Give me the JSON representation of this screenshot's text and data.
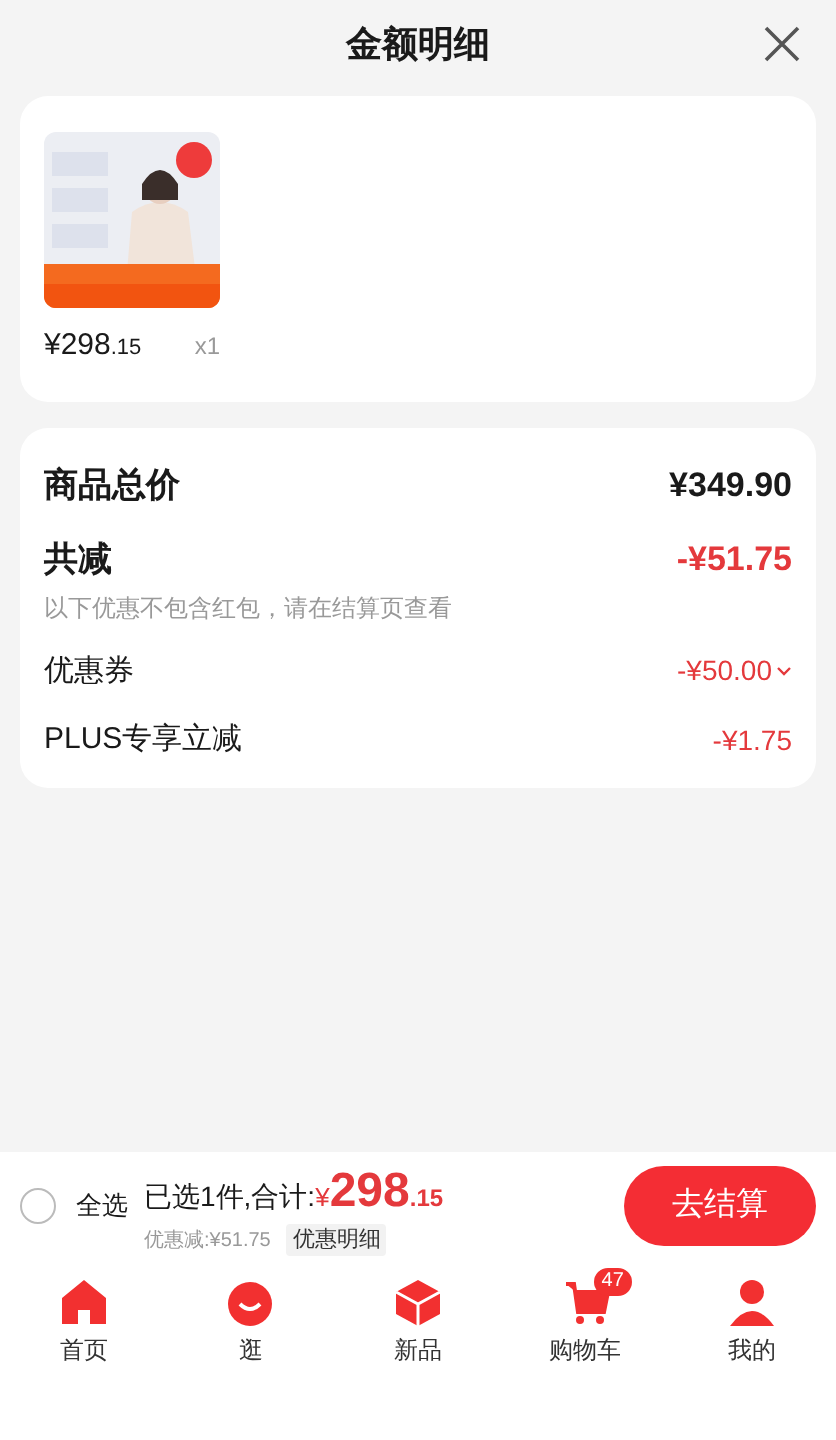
{
  "header": {
    "title": "金额明细"
  },
  "product": {
    "price_main": "¥298",
    "price_decimal": ".15",
    "quantity": "x1"
  },
  "summary": {
    "rows": [
      {
        "kind": "total",
        "label": "商品总价",
        "value": "¥349.90"
      },
      {
        "kind": "discount_total",
        "label": "共减",
        "value": "-¥51.75",
        "note": "以下优惠不包含红包，请在结算页查看"
      },
      {
        "kind": "item",
        "label": "优惠券",
        "value": "-¥50.00",
        "expanded": false
      },
      {
        "kind": "item",
        "label": "PLUS专享立减",
        "value": "-¥1.75"
      }
    ]
  },
  "checkout_bar": {
    "select_all": {
      "label": "全选",
      "checked": false
    },
    "selected_text": "已选1件,合计:",
    "currency": "¥",
    "total_main": "298",
    "total_decimal": ".15",
    "discount_text": "优惠减:¥51.75",
    "detail_link": "优惠明细",
    "button": "去结算"
  },
  "tab_bar": [
    {
      "kind": "home",
      "label": "首页"
    },
    {
      "kind": "browse",
      "label": "逛"
    },
    {
      "kind": "new",
      "label": "新品"
    },
    {
      "kind": "cart",
      "label": "购物车",
      "badge": "47"
    },
    {
      "kind": "me",
      "label": "我的"
    }
  ]
}
